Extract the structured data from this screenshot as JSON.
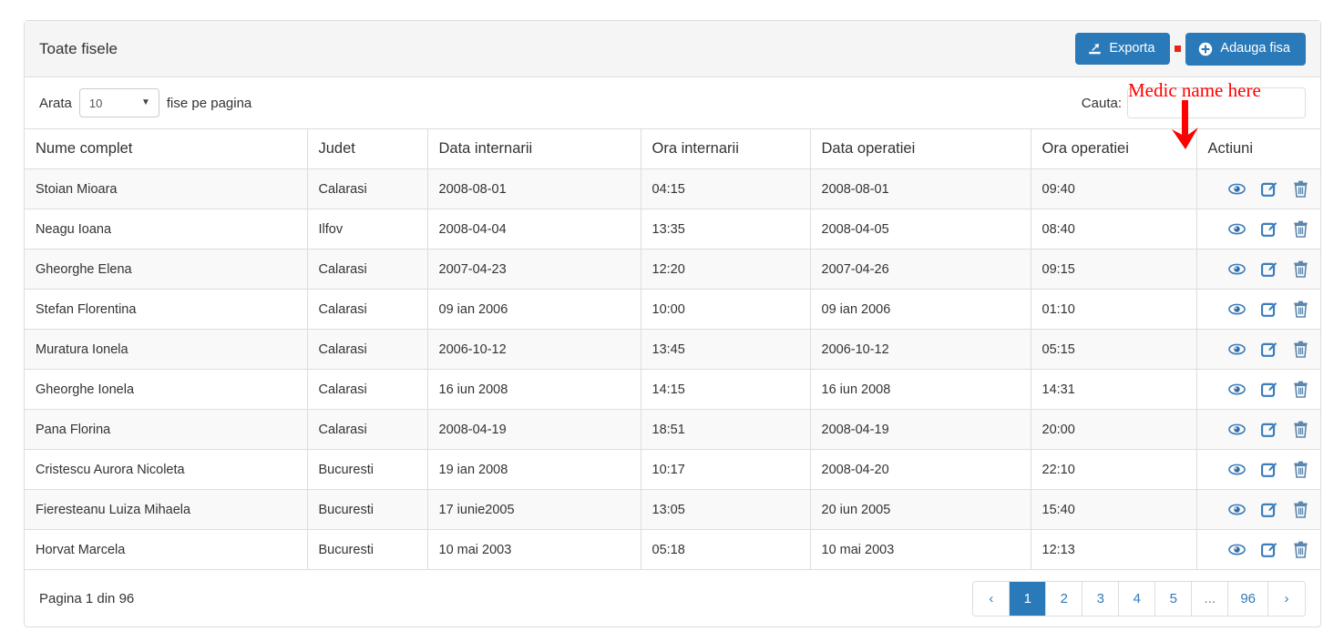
{
  "panel": {
    "title": "Toate fisele",
    "export_button": "Exporta",
    "add_button": "Adauga fisa"
  },
  "controls": {
    "length_prefix": "Arata",
    "length_value": "10",
    "length_suffix": "fise pe pagina",
    "search_label": "Cauta:",
    "search_value": "",
    "search_placeholder": ""
  },
  "annotation": {
    "text": "Medic name here",
    "color": "#ff0000"
  },
  "table": {
    "headers": [
      "Nume complet",
      "Judet",
      "Data internarii",
      "Ora internarii",
      "Data operatiei",
      "Ora operatiei",
      "Actiuni"
    ],
    "rows": [
      {
        "nume": "Stoian Mioara",
        "judet": "Calarasi",
        "data_internarii": "2008-08-01",
        "ora_internarii": "04:15",
        "data_operatiei": "2008-08-01",
        "ora_operatiei": "09:40"
      },
      {
        "nume": "Neagu Ioana",
        "judet": "Ilfov",
        "data_internarii": "2008-04-04",
        "ora_internarii": "13:35",
        "data_operatiei": "2008-04-05",
        "ora_operatiei": "08:40"
      },
      {
        "nume": "Gheorghe Elena",
        "judet": "Calarasi",
        "data_internarii": "2007-04-23",
        "ora_internarii": "12:20",
        "data_operatiei": "2007-04-26",
        "ora_operatiei": "09:15"
      },
      {
        "nume": "Stefan Florentina",
        "judet": "Calarasi",
        "data_internarii": "09 ian 2006",
        "ora_internarii": "10:00",
        "data_operatiei": "09 ian 2006",
        "ora_operatiei": "01:10"
      },
      {
        "nume": "Muratura Ionela",
        "judet": "Calarasi",
        "data_internarii": "2006-10-12",
        "ora_internarii": "13:45",
        "data_operatiei": "2006-10-12",
        "ora_operatiei": "05:15"
      },
      {
        "nume": "Gheorghe Ionela",
        "judet": "Calarasi",
        "data_internarii": "16 iun 2008",
        "ora_internarii": "14:15",
        "data_operatiei": "16 iun 2008",
        "ora_operatiei": "14:31"
      },
      {
        "nume": "Pana Florina",
        "judet": "Calarasi",
        "data_internarii": "2008-04-19",
        "ora_internarii": "18:51",
        "data_operatiei": "2008-04-19",
        "ora_operatiei": "20:00"
      },
      {
        "nume": "Cristescu Aurora Nicoleta",
        "judet": "Bucuresti",
        "data_internarii": "19 ian 2008",
        "ora_internarii": "10:17",
        "data_operatiei": "2008-04-20",
        "ora_operatiei": "22:10"
      },
      {
        "nume": "Fieresteanu Luiza Mihaela",
        "judet": "Bucuresti",
        "data_internarii": "17 iunie2005",
        "ora_internarii": "13:05",
        "data_operatiei": "20 iun 2005",
        "ora_operatiei": "15:40"
      },
      {
        "nume": "Horvat Marcela",
        "judet": "Bucuresti",
        "data_internarii": "10 mai 2003",
        "ora_internarii": "05:18",
        "data_operatiei": "10 mai 2003",
        "ora_operatiei": "12:13"
      }
    ],
    "row_actions": [
      "view-icon",
      "edit-icon",
      "delete-icon"
    ]
  },
  "footer": {
    "page_info": "Pagina 1 din 96",
    "pagination": [
      {
        "label": "‹",
        "type": "prev"
      },
      {
        "label": "1",
        "type": "page",
        "active": true
      },
      {
        "label": "2",
        "type": "page"
      },
      {
        "label": "3",
        "type": "page"
      },
      {
        "label": "4",
        "type": "page"
      },
      {
        "label": "5",
        "type": "page"
      },
      {
        "label": "...",
        "type": "dots"
      },
      {
        "label": "96",
        "type": "page"
      },
      {
        "label": "›",
        "type": "next"
      }
    ]
  },
  "colors": {
    "primary": "#2a7ab9",
    "link": "#337ab7",
    "annotation": "#ff0000",
    "separator": "#e8231a"
  }
}
